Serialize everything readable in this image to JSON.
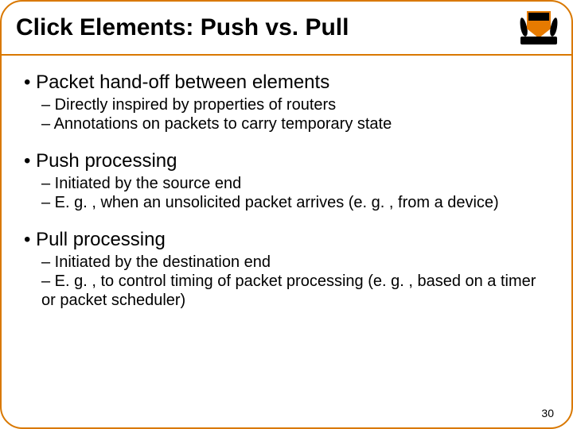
{
  "title": "Click Elements: Push vs. Pull",
  "sections": [
    {
      "heading": "• Packet hand-off between elements",
      "subs": [
        "– Directly inspired by properties of routers",
        "– Annotations on packets to carry temporary state"
      ]
    },
    {
      "heading": "• Push processing",
      "subs": [
        "– Initiated by the source end",
        "– E. g. , when an unsolicited packet arrives (e. g. , from a device)"
      ]
    },
    {
      "heading": "• Pull processing",
      "subs": [
        "– Initiated by the destination end",
        "– E. g. , to control timing of packet processing (e. g. , based on a timer or packet scheduler)"
      ]
    }
  ],
  "page_number": "30"
}
